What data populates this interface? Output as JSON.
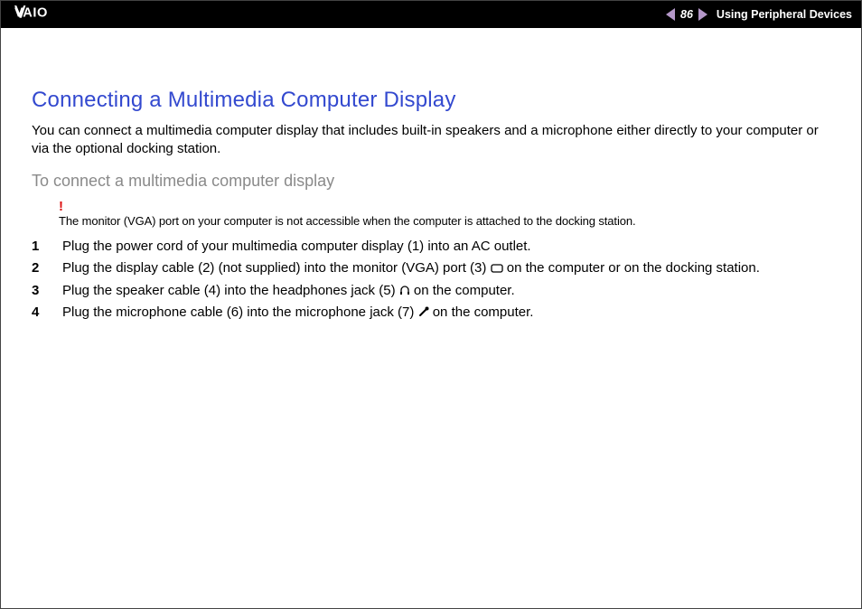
{
  "header": {
    "page_number": "86",
    "section": "Using Peripheral Devices"
  },
  "title": "Connecting a Multimedia Computer Display",
  "intro": "You can connect a multimedia computer display that includes built-in speakers and a microphone either directly to your computer or via the optional docking station.",
  "subheading": "To connect a multimedia computer display",
  "warning": {
    "mark": "!",
    "text": "The monitor (VGA) port on your computer is not accessible when the computer is attached to the docking station."
  },
  "steps": [
    {
      "pre": "Plug the power cord of your multimedia computer display (1) into an AC outlet.",
      "icon": null,
      "post": ""
    },
    {
      "pre": "Plug the display cable (2) (not supplied) into the monitor (VGA) port (3) ",
      "icon": "vga",
      "post": " on the computer or on the docking station."
    },
    {
      "pre": "Plug the speaker cable (4) into the headphones jack (5) ",
      "icon": "headphones",
      "post": " on the computer."
    },
    {
      "pre": "Plug the microphone cable (6) into the microphone jack (7) ",
      "icon": "mic",
      "post": " on the computer."
    }
  ]
}
